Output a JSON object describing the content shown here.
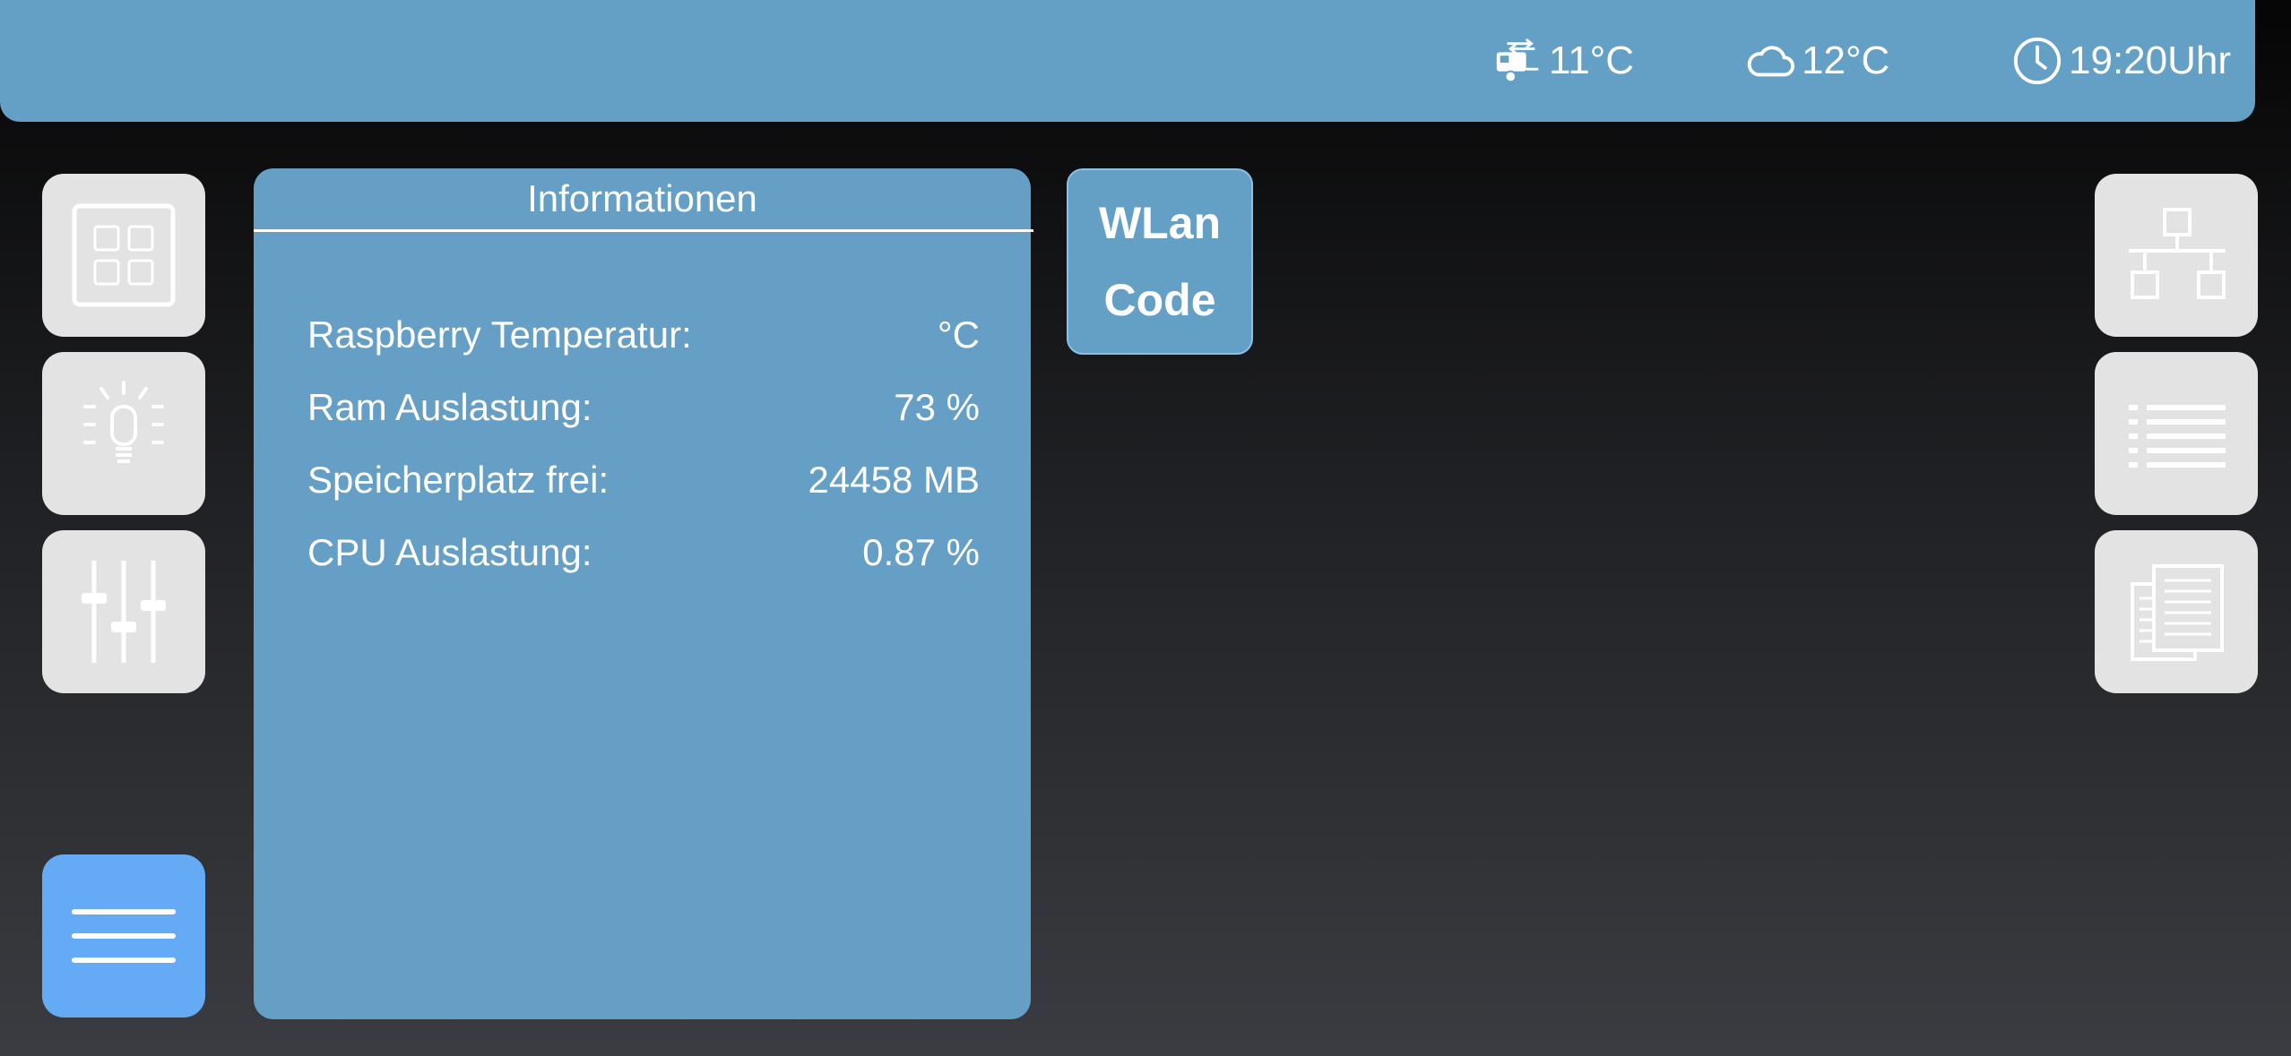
{
  "status_bar": {
    "outside_temp": "11°C",
    "weather_temp": "12°C",
    "time": "19:20Uhr"
  },
  "left_nav": [
    {
      "icon": "grid-icon"
    },
    {
      "icon": "light-bulb-icon"
    },
    {
      "icon": "sliders-icon"
    },
    {
      "icon": "menu-icon",
      "active": true
    }
  ],
  "right_nav": [
    {
      "icon": "network-icon"
    },
    {
      "icon": "list-icon"
    },
    {
      "icon": "documents-icon"
    }
  ],
  "info_panel": {
    "title": "Informationen",
    "rows": [
      {
        "label": "Raspberry Temperatur:",
        "value": "°C"
      },
      {
        "label": "Ram Auslastung:",
        "value": "73 %"
      },
      {
        "label": "Speicherplatz frei:",
        "value": "24458 MB"
      },
      {
        "label": "CPU Auslastung:",
        "value": "0.87 %"
      }
    ]
  },
  "wlan_button": {
    "line1": "WLan",
    "line2": "Code"
  },
  "colors": {
    "bar": "#64a0c6",
    "panel": "#659fc6",
    "tile": "#e3e3e3",
    "tile_active": "#64aaf4"
  }
}
